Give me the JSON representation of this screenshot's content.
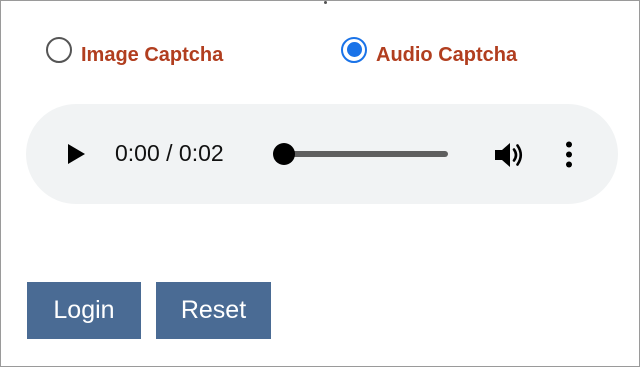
{
  "captcha_options": {
    "image_label": "Image Captcha",
    "audio_label": "Audio Captcha",
    "selected": "audio"
  },
  "audio_player": {
    "time_display": "0:00 / 0:02",
    "progress": 0
  },
  "buttons": {
    "login_label": "Login",
    "reset_label": "Reset"
  },
  "colors": {
    "label_color": "#b13e1f",
    "radio_accent": "#1a73e8",
    "button_bg": "#4a6b94",
    "player_bg": "#f1f3f4"
  },
  "icons": {
    "play": "play-icon",
    "volume": "volume-icon",
    "more": "more-vertical-icon"
  }
}
